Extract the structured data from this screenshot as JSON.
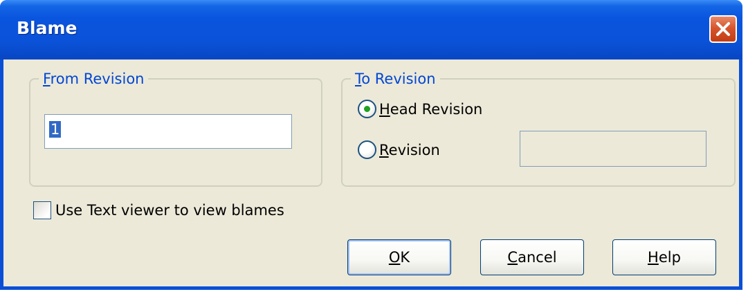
{
  "window": {
    "title": "Blame",
    "close_icon": "close-icon"
  },
  "from_revision": {
    "legend_first": "F",
    "legend_rest": "rom Revision",
    "value": "1"
  },
  "to_revision": {
    "legend_first": "T",
    "legend_rest": "o Revision",
    "head_first": "H",
    "head_rest": "ead Revision",
    "head_selected": true,
    "revision_first": "R",
    "revision_rest": "evision",
    "revision_value": ""
  },
  "options": {
    "use_text_viewer_label": "Use Text viewer to view blames",
    "use_text_viewer_checked": false
  },
  "buttons": {
    "ok_first": "O",
    "ok_rest": "K",
    "cancel_first": "C",
    "cancel_rest": "ancel",
    "help_first": "H",
    "help_rest": "elp"
  },
  "colors": {
    "title_bar": "#0a52d8",
    "dialog_bg": "#ece9d8",
    "group_label": "#0046d5",
    "close_button": "#d6552e"
  }
}
